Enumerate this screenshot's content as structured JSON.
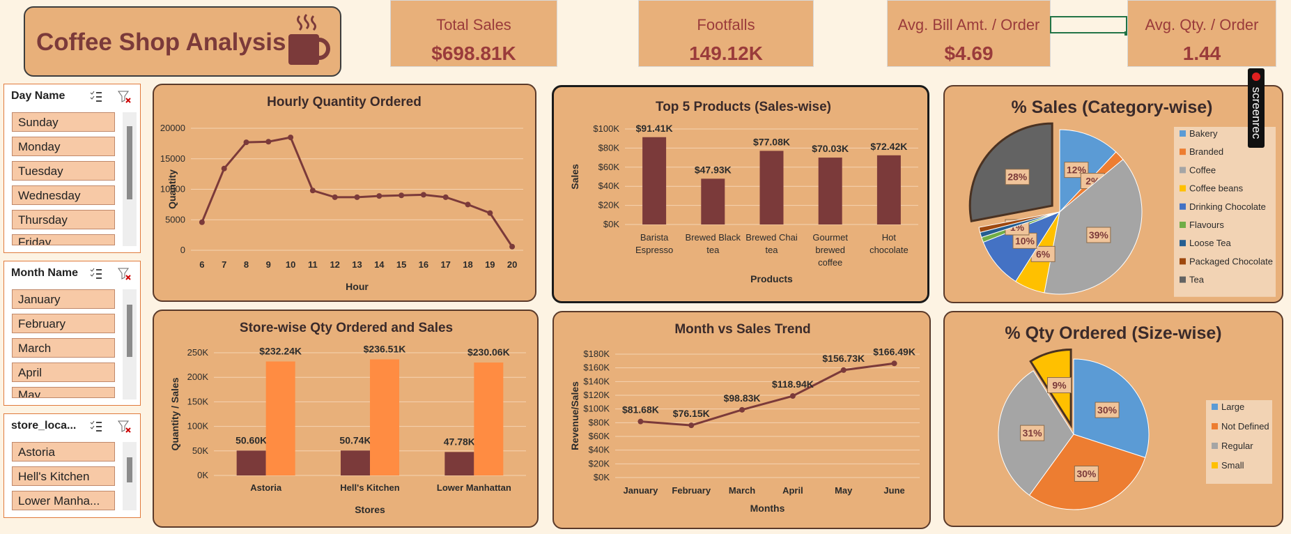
{
  "header": {
    "title": "Coffee Shop Analysis"
  },
  "kpis": [
    {
      "label": "Total Sales",
      "value": "$698.81K"
    },
    {
      "label": "Footfalls",
      "value": "149.12K"
    },
    {
      "label": "Avg. Bill Amt. / Order",
      "value": "$4.69"
    },
    {
      "label": "Avg. Qty. / Order",
      "value": "1.44"
    }
  ],
  "slicers": [
    {
      "title": "Day Name",
      "items": [
        "Sunday",
        "Monday",
        "Tuesday",
        "Wednesday",
        "Thursday",
        "Friday"
      ]
    },
    {
      "title": "Month Name",
      "items": [
        "January",
        "February",
        "March",
        "April",
        "May"
      ]
    },
    {
      "title": "store_loca...",
      "items": [
        "Astoria",
        "Hell's Kitchen",
        "Lower Manha..."
      ]
    }
  ],
  "overlay": {
    "recorder_label": "screenrec"
  },
  "colors": {
    "panel": "#e8b07a",
    "accent": "#7b3a3a",
    "orange": "#ff8c42"
  },
  "chart_data": [
    {
      "id": "hourly",
      "type": "line",
      "title": "Hourly Quantity Ordered",
      "xlabel": "Hour",
      "ylabel": "Quantity",
      "x": [
        6,
        7,
        8,
        9,
        10,
        11,
        12,
        13,
        14,
        15,
        16,
        17,
        18,
        19,
        20
      ],
      "values": [
        4600,
        13400,
        17700,
        17800,
        18500,
        9800,
        8700,
        8700,
        8900,
        9000,
        9100,
        8700,
        7500,
        6100,
        600
      ],
      "ylim": [
        0,
        20000
      ],
      "yticks": [
        0,
        5000,
        10000,
        15000,
        20000
      ],
      "grid": true
    },
    {
      "id": "top5",
      "type": "bar",
      "title": "Top 5  Products (Sales-wise)",
      "xlabel": "Products",
      "ylabel": "Sales",
      "categories": [
        "Barista Espresso",
        "Brewed Black tea",
        "Brewed Chai tea",
        "Gourmet brewed coffee",
        "Hot chocolate"
      ],
      "category_lines": [
        [
          "Barista",
          "Espresso"
        ],
        [
          "Brewed Black",
          "tea"
        ],
        [
          "Brewed Chai",
          "tea"
        ],
        [
          "Gourmet",
          "brewed",
          "coffee"
        ],
        [
          "Hot",
          "chocolate"
        ]
      ],
      "values": [
        91410,
        47930,
        77080,
        70030,
        72420
      ],
      "labels": [
        "$91.41K",
        "$47.93K",
        "$77.08K",
        "$70.03K",
        "$72.42K"
      ],
      "ylim": [
        0,
        100000
      ],
      "yticks": [
        "$0K",
        "$20K",
        "$40K",
        "$60K",
        "$80K",
        "$100K"
      ],
      "grid": true
    },
    {
      "id": "category",
      "type": "pie",
      "title": "% Sales (Category-wise)",
      "legend": "right",
      "slices": [
        {
          "name": "Bakery",
          "value": 12,
          "label": "12%",
          "color": "#5b9bd5"
        },
        {
          "name": "Branded",
          "value": 2,
          "label": "2%",
          "color": "#ed7d31"
        },
        {
          "name": "Coffee",
          "value": 39,
          "label": "39%",
          "color": "#a5a5a5"
        },
        {
          "name": "Coffee beans",
          "value": 6,
          "label": "6%",
          "color": "#ffc000"
        },
        {
          "name": "Drinking Chocolate",
          "value": 10,
          "label": "10%",
          "color": "#4472c4"
        },
        {
          "name": "Flavours",
          "value": 1,
          "label": "1%",
          "color": "#70ad47"
        },
        {
          "name": "Loose Tea",
          "value": 1,
          "label": "",
          "color": "#255e91"
        },
        {
          "name": "Packaged Chocolate",
          "value": 1,
          "label": "",
          "color": "#9e480e"
        },
        {
          "name": "Tea",
          "value": 28,
          "label": "28%",
          "color": "#636363"
        }
      ]
    },
    {
      "id": "store",
      "type": "bar",
      "title": "Store-wise Qty Ordered and Sales",
      "xlabel": "Stores",
      "ylabel": "Quantity / Sales",
      "categories": [
        "Astoria",
        "Hell's Kitchen",
        "Lower Manhattan"
      ],
      "series": [
        {
          "values": [
            50600,
            50740,
            47780
          ],
          "labels": [
            "50.60K",
            "50.74K",
            "47.78K"
          ],
          "color": "#7b3a3a"
        },
        {
          "values": [
            232240,
            236510,
            230060
          ],
          "labels": [
            "$232.24K",
            "$236.51K",
            "$230.06K"
          ],
          "color": "#ff8c42"
        }
      ],
      "ylim": [
        0,
        250000
      ],
      "yticks": [
        "0K",
        "50K",
        "100K",
        "150K",
        "200K",
        "250K"
      ],
      "grid": true
    },
    {
      "id": "month",
      "type": "line",
      "title": "Month vs Sales Trend",
      "xlabel": "Months",
      "ylabel": "Revenue/Sales",
      "categories": [
        "January",
        "February",
        "March",
        "April",
        "May",
        "June"
      ],
      "values": [
        81680,
        76150,
        98830,
        118940,
        156730,
        166490
      ],
      "labels": [
        "$81.68K",
        "$76.15K",
        "$98.83K",
        "$118.94K",
        "$156.73K",
        "$166.49K"
      ],
      "ylim": [
        0,
        180000
      ],
      "yticks": [
        "$0K",
        "$20K",
        "$40K",
        "$60K",
        "$80K",
        "$100K",
        "$120K",
        "$140K",
        "$160K",
        "$180K"
      ],
      "grid": true
    },
    {
      "id": "size",
      "type": "pie",
      "title": "% Qty Ordered (Size-wise)",
      "legend": "right",
      "slices": [
        {
          "name": "Large",
          "value": 30,
          "label": "30%",
          "color": "#5b9bd5"
        },
        {
          "name": "Not Defined",
          "value": 30,
          "label": "30%",
          "color": "#ed7d31"
        },
        {
          "name": "Regular",
          "value": 31,
          "label": "31%",
          "color": "#a5a5a5"
        },
        {
          "name": "Small",
          "value": 9,
          "label": "9%",
          "color": "#ffc000"
        }
      ]
    }
  ]
}
